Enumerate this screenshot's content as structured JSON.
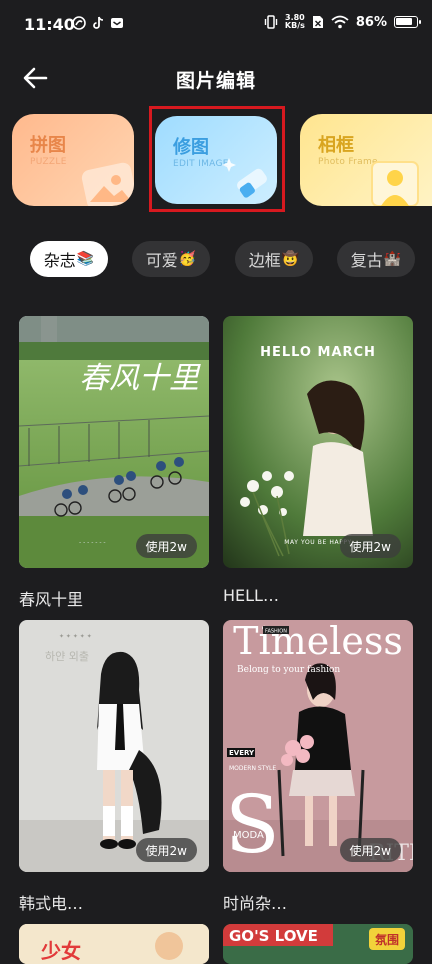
{
  "status_bar": {
    "time": "11:40",
    "net_speed_value": "3.80",
    "net_speed_unit": "KB/s",
    "battery_percent": "86%",
    "battery_level": 0.86
  },
  "header": {
    "title": "图片编辑"
  },
  "cards": [
    {
      "title": "拼图",
      "subtitle": "PUZZLE"
    },
    {
      "title": "修图",
      "subtitle": "EDIT IMAGE"
    },
    {
      "title": "相框",
      "subtitle": "Photo Frame"
    }
  ],
  "chips": [
    {
      "label": "杂志",
      "emoji": "📚"
    },
    {
      "label": "可爱",
      "emoji": "🥳"
    },
    {
      "label": "边框",
      "emoji": "🤠"
    },
    {
      "label": "复古",
      "emoji": "🏰"
    }
  ],
  "templates": [
    {
      "title": "春风十里",
      "usage": "使用2w",
      "overlay": "春风十里"
    },
    {
      "title": "HELL…",
      "usage": "使用2w",
      "overlay": "HELLO MARCH",
      "caption": "MAY YOU BE HAPPY"
    },
    {
      "title": "韩式电…",
      "usage": "使用2w",
      "overlay": "하얀 외출"
    },
    {
      "title": "时尚杂…",
      "usage": "使用2w",
      "overlay": "Timeless",
      "fashion": "FASHION",
      "tagline": "Belong to your fashion",
      "every": "EVERY",
      "modern": "MODERN STYLE",
      "big_s": "S",
      "moda": "MODA",
      "rite": "RITE"
    }
  ],
  "partial_row": {
    "left_text": "少女",
    "right_text": "GO'S LOVE",
    "right_badge": "氛围"
  }
}
